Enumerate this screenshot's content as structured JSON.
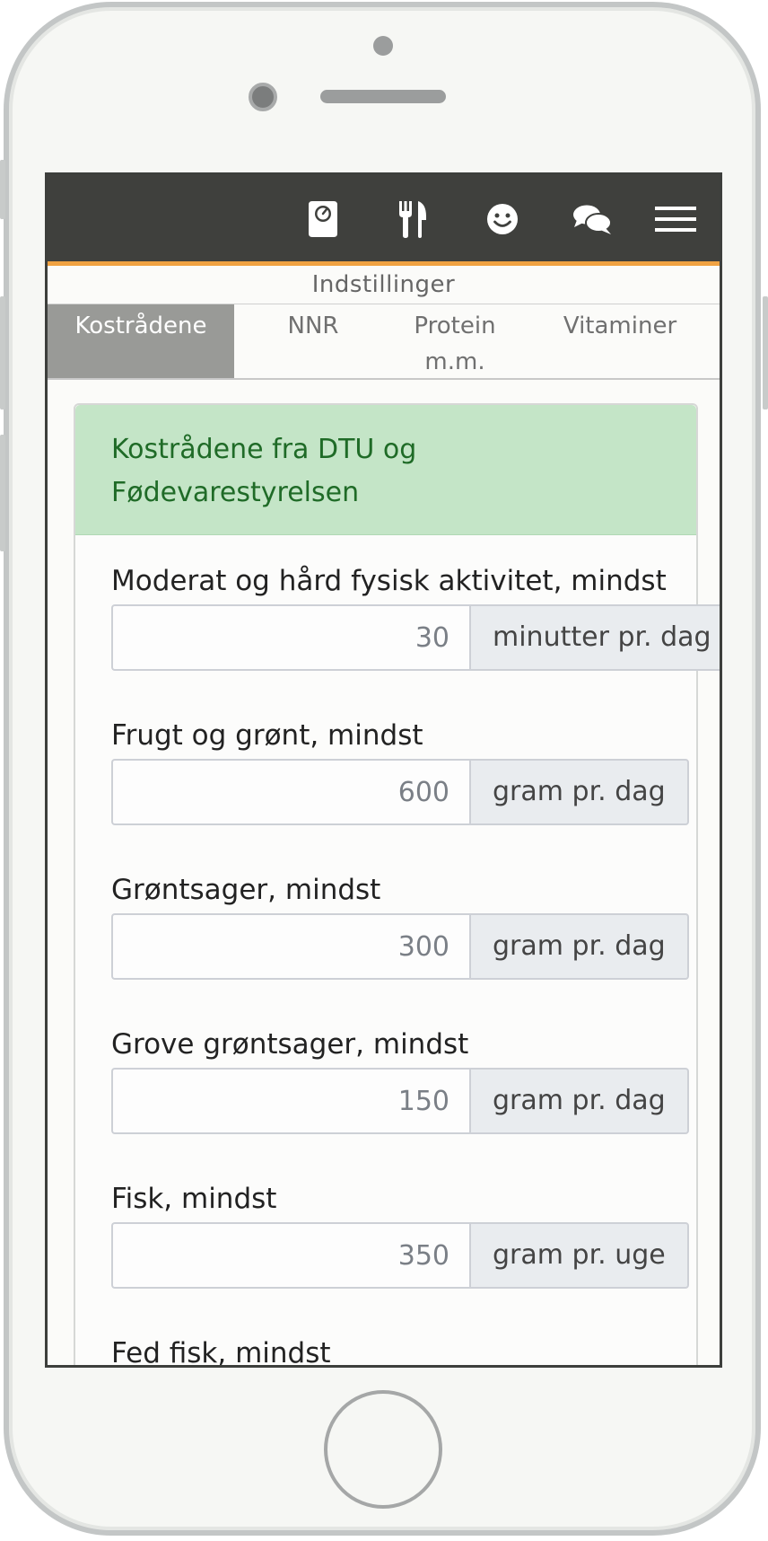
{
  "header": {
    "icons": [
      "scale-icon",
      "fork-knife-icon",
      "smiley-icon",
      "chat-icon",
      "hamburger-menu-icon"
    ]
  },
  "page_title": "Indstillinger",
  "tabs": [
    {
      "label": "Kostrådene",
      "active": true
    },
    {
      "label": "NNR",
      "active": false
    },
    {
      "label": "Protein m.m.",
      "active": false
    },
    {
      "label": "Vitaminer",
      "active": false
    }
  ],
  "panel": {
    "heading": "Kostrådene fra DTU og Fødevarestyrelsen",
    "fields": [
      {
        "label": "Moderat og hård fysisk aktivitet, mindst",
        "value": "30",
        "unit": "minutter pr. dag"
      },
      {
        "label": "Frugt og grønt, mindst",
        "value": "600",
        "unit": "gram pr. dag"
      },
      {
        "label": "Grøntsager, mindst",
        "value": "300",
        "unit": "gram pr. dag"
      },
      {
        "label": "Grove grøntsager, mindst",
        "value": "150",
        "unit": "gram pr. dag"
      },
      {
        "label": "Fisk, mindst",
        "value": "350",
        "unit": "gram pr. uge"
      },
      {
        "label": "Fed fisk, mindst"
      }
    ]
  },
  "colors": {
    "topbar": "#3f403d",
    "accent_line": "#f0a242",
    "active_tab": "#999a97",
    "panel_header_bg": "#c4e5c7",
    "panel_header_text": "#1f6b27"
  }
}
